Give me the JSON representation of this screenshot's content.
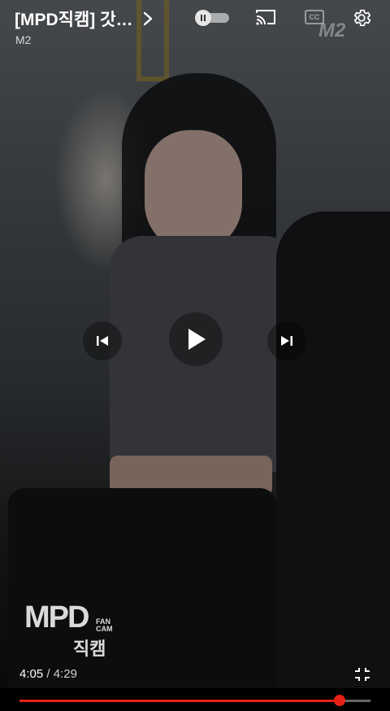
{
  "video": {
    "title": "[MPD직캠] 갓…",
    "channel": "M2",
    "watermark_top": "M2"
  },
  "controls": {
    "autoplay_state": "paused",
    "captions_label": "CC",
    "icons": {
      "chevron": "chevron-right-icon",
      "cast": "cast-icon",
      "settings": "gear-icon",
      "previous": "skip-previous-icon",
      "play": "play-icon",
      "next": "skip-next-icon",
      "fullscreen": "exit-fullscreen-icon"
    }
  },
  "watermark": {
    "logo": "MPD",
    "fan": "FAN",
    "cam": "CAM",
    "korean": "직캠"
  },
  "playback": {
    "current_time": "4:05",
    "separator": "/",
    "duration": "4:29",
    "progress_fraction": 0.911
  },
  "colors": {
    "progress": "#e62117",
    "track": "#666666",
    "text": "#ffffff"
  }
}
